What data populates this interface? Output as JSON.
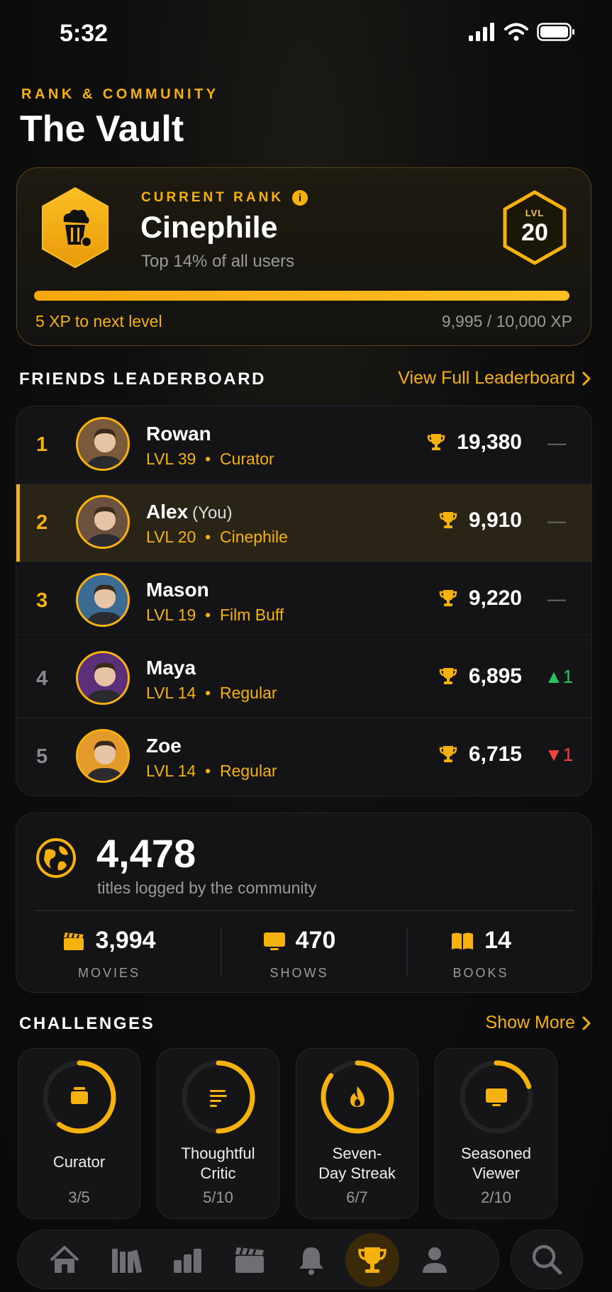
{
  "status_bar": {
    "time": "5:32"
  },
  "header": {
    "eyebrow": "RANK & COMMUNITY",
    "title": "The Vault"
  },
  "rank_card": {
    "eyebrow": "CURRENT RANK",
    "rank_name": "Cinephile",
    "subtitle": "Top 14% of all users",
    "level_label": "LVL",
    "level": "20",
    "xp_progress": 0.9995,
    "xp_left_text": "5 XP to next level",
    "xp_total_text": "9,995 / 10,000 XP"
  },
  "leaderboard": {
    "title": "FRIENDS LEADERBOARD",
    "link": "View Full Leaderboard",
    "rows": [
      {
        "rank": "1",
        "name": "Rowan",
        "you": "",
        "level": "LVL 39",
        "title": "Curator",
        "score": "19,380",
        "change": "—",
        "trend": "none",
        "avatar_bg": "#7a5a3a"
      },
      {
        "rank": "2",
        "name": "Alex",
        "you": "(You)",
        "level": "LVL 20",
        "title": "Cinephile",
        "score": "9,910",
        "change": "—",
        "trend": "none",
        "avatar_bg": "#6b5240"
      },
      {
        "rank": "3",
        "name": "Mason",
        "you": "",
        "level": "LVL 19",
        "title": "Film Buff",
        "score": "9,220",
        "change": "—",
        "trend": "none",
        "avatar_bg": "#3b6a93"
      },
      {
        "rank": "4",
        "name": "Maya",
        "you": "",
        "level": "LVL 14",
        "title": "Regular",
        "score": "6,895",
        "change": "▲1",
        "trend": "up",
        "avatar_bg": "#5b2f7a"
      },
      {
        "rank": "5",
        "name": "Zoe",
        "you": "",
        "level": "LVL 14",
        "title": "Regular",
        "score": "6,715",
        "change": "▼1",
        "trend": "down",
        "avatar_bg": "#e49a2a"
      }
    ]
  },
  "community": {
    "total": "4,478",
    "caption": "titles logged by the community",
    "stats": [
      {
        "value": "3,994",
        "label": "MOVIES",
        "icon": "clapperboard-icon"
      },
      {
        "value": "470",
        "label": "SHOWS",
        "icon": "tv-icon"
      },
      {
        "value": "14",
        "label": "BOOKS",
        "icon": "book-icon"
      }
    ]
  },
  "challenges": {
    "title": "CHALLENGES",
    "link": "Show More",
    "items": [
      {
        "name": "Curator",
        "progress": "3/5",
        "fraction": 0.6,
        "icon": "box-icon"
      },
      {
        "name": "Thoughtful Critic",
        "progress": "5/10",
        "fraction": 0.5,
        "icon": "lines-icon"
      },
      {
        "name": "Seven-Day Streak",
        "progress": "6/7",
        "fraction": 0.857,
        "icon": "flame-icon"
      },
      {
        "name": "Seasoned Viewer",
        "progress": "2/10",
        "fraction": 0.2,
        "icon": "tv-icon"
      }
    ]
  },
  "tab_bar": {
    "tabs": [
      "home-icon",
      "library-icon",
      "stats-icon",
      "clapperboard-icon",
      "bell-icon",
      "trophy-icon",
      "profile-icon"
    ],
    "active": "trophy-icon",
    "search": "search-icon"
  },
  "colors": {
    "accent": "#f5b10e",
    "up": "#22c55e",
    "down": "#ef4444",
    "muted": "#9a9a9a"
  }
}
